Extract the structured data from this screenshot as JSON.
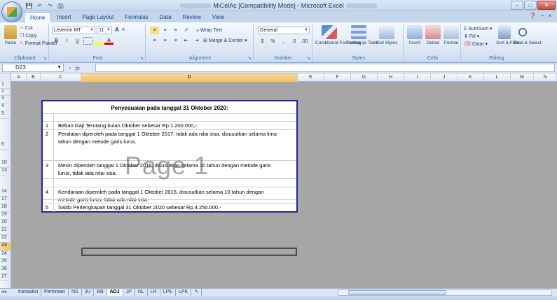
{
  "window": {
    "title_prefix": "",
    "title_main": "MiCelAc  [Compatibility Mode] - Microsoft Excel",
    "minimize": "–",
    "maximize": "□",
    "close": "✕"
  },
  "qat": {
    "save": "💾",
    "undo": "↶",
    "redo": "↷",
    "print": "🖨"
  },
  "tabs": [
    {
      "label": "Home"
    },
    {
      "label": "Insert"
    },
    {
      "label": "Page Layout"
    },
    {
      "label": "Formulas"
    },
    {
      "label": "Data"
    },
    {
      "label": "Review"
    },
    {
      "label": "View"
    }
  ],
  "tab_icons": {
    "help": "❓",
    "ribbon_min": "–",
    "close": "×"
  },
  "ribbon": {
    "clipboard": {
      "paste": "Paste",
      "cut": "Cut",
      "copy": "Copy",
      "format_painter": "Format Painter",
      "label": "Clipboard"
    },
    "font": {
      "name": "Levenim MT",
      "size": "11",
      "label": "Font",
      "bold": "B",
      "italic": "I",
      "underline": "U",
      "grow": "A",
      "shrink": "A"
    },
    "alignment": {
      "wrap": "Wrap Text",
      "merge": "Merge & Center",
      "label": "Alignment"
    },
    "number": {
      "format": "General",
      "currency": "$",
      "percent": "%",
      "comma": ",",
      "label": "Number"
    },
    "styles": {
      "conditional": "Conditional Formatting",
      "format_table": "Format as Table",
      "cell_styles": "Cell Styles",
      "label": "Styles"
    },
    "cells": {
      "insert": "Insert",
      "delete": "Delete",
      "format": "Format",
      "label": "Cells"
    },
    "editing": {
      "autosum": "AutoSum",
      "fill": "Fill",
      "clear": "Clear",
      "sort": "Sort & Filter",
      "find": "Find & Select",
      "label": "Editing"
    }
  },
  "formula_bar": {
    "name_box": "D23",
    "fx": "fx",
    "value": ""
  },
  "columns": [
    "A",
    "B",
    "C",
    "D",
    "E",
    "F",
    "G",
    "H",
    "I",
    "J",
    "K",
    "L",
    "M",
    "N"
  ],
  "rows": [
    "1",
    "2",
    "3",
    "4",
    "5",
    "6",
    "10",
    "13",
    "14",
    "17",
    "18",
    "19",
    "20",
    "21",
    "22",
    "23",
    "24",
    "25",
    "26",
    "27"
  ],
  "selected": {
    "column": "D",
    "row": "23"
  },
  "sheet": {
    "title": "Penyesuaian pada tanggal 31 Oktober 2020:",
    "items": [
      {
        "num": "1",
        "text": "Beban Gaji Terutang bulan Oktober sebesar Rp.1.200.000,-"
      },
      {
        "num": "2",
        "text": "Peralatan diperoleh pada tanggal 1 Oktober 2017, tidak ada nilai sisa, disusutkan selama lima tahun dengan metode garis lurus."
      },
      {
        "num": "3",
        "text": "Mesin diperoleh tanggal 1 Oktober 2016, disusutkan selama 10 tahun dengan metode garis lurus, tidak ada nilai sisa."
      },
      {
        "num": "4",
        "text": "Kendaraan diperoleh pada tanggal 1 Oktober 2016, disusutkan selama 10 tahun dengan metode garis lurus, tidak ada nilai sisa."
      },
      {
        "num": "5",
        "text": "Saldo Perlengkapan tanggal 31 Oktober 2020 sebesar Rp.4.250.000,-"
      }
    ],
    "watermark": "Page 1"
  },
  "sheet_tabs": [
    {
      "label": "transaksi"
    },
    {
      "label": "Perkiraan"
    },
    {
      "label": "NS"
    },
    {
      "label": "JU"
    },
    {
      "label": "BB"
    },
    {
      "label": "ADJ",
      "active": true
    },
    {
      "label": "JP"
    },
    {
      "label": "NL"
    },
    {
      "label": "LR"
    },
    {
      "label": "LPE"
    },
    {
      "label": "LPK"
    }
  ],
  "nav": {
    "first": "◄◄",
    "prev": "◄",
    "next": "►",
    "last": "►►"
  }
}
